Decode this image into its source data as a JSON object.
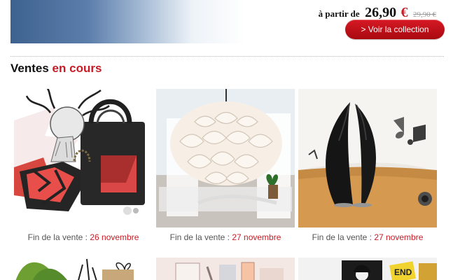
{
  "hero": {
    "prefix": "à partir de",
    "price": "26,90",
    "currency": "€",
    "old_price": "29,90 €",
    "button_label": "> Voir la collection"
  },
  "section": {
    "title_main": "Ventes",
    "title_accent": "en cours"
  },
  "sales": [
    {
      "label": "Fin de la vente :",
      "date": "26 novembre"
    },
    {
      "label": "Fin de la vente :",
      "date": "27 novembre"
    },
    {
      "label": "Fin de la vente :",
      "date": "27 novembre"
    }
  ],
  "colors": {
    "accent": "#c71b25",
    "hero_blue": "#3e628f",
    "text": "#111111"
  },
  "bottom_row": {
    "item_4_sign": "END"
  }
}
